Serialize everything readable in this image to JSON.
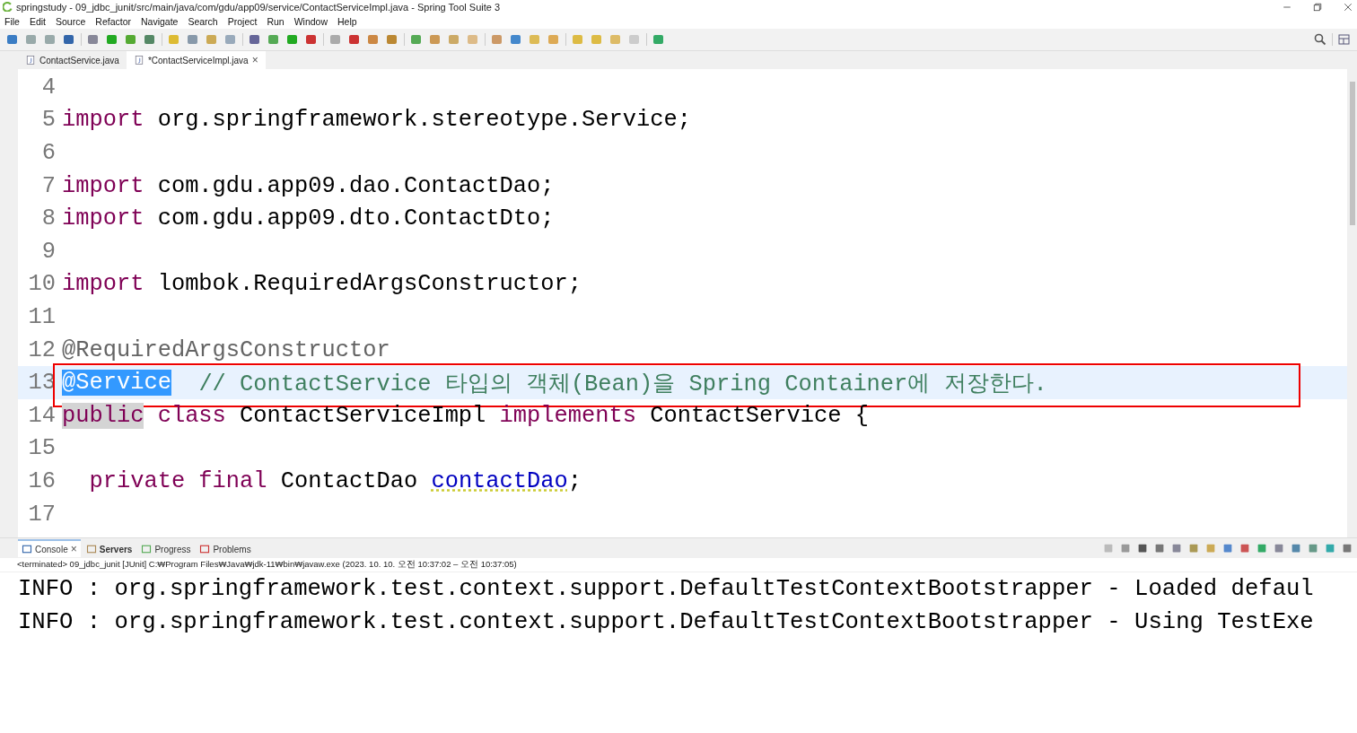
{
  "window": {
    "title": "springstudy - 09_jdbc_junit/src/main/java/com/gdu/app09/service/ContactServiceImpl.java - Spring Tool Suite 3"
  },
  "menu": [
    "File",
    "Edit",
    "Source",
    "Refactor",
    "Navigate",
    "Search",
    "Project",
    "Run",
    "Window",
    "Help"
  ],
  "editor_tabs": [
    {
      "label": "ContactService.java",
      "selected": false
    },
    {
      "label": "*ContactServiceImpl.java",
      "selected": true,
      "close": "×"
    }
  ],
  "code_lines": [
    {
      "number": "4",
      "current": false,
      "boxed": false
    },
    {
      "number": "5",
      "current": false,
      "boxed": false,
      "segments": [
        {
          "kind": "keyword",
          "text": "import"
        },
        {
          "kind": "plain",
          "text": " org.springframework.stereotype.Service;"
        }
      ]
    },
    {
      "number": "6",
      "current": false,
      "boxed": false
    },
    {
      "number": "7",
      "current": false,
      "boxed": false,
      "segments": [
        {
          "kind": "keyword",
          "text": "import"
        },
        {
          "kind": "plain",
          "text": " com.gdu.app09.dao.ContactDao;"
        }
      ]
    },
    {
      "number": "8",
      "current": false,
      "boxed": false,
      "segments": [
        {
          "kind": "keyword",
          "text": "import"
        },
        {
          "kind": "plain",
          "text": " com.gdu.app09.dto.ContactDto;"
        }
      ]
    },
    {
      "number": "9",
      "current": false,
      "boxed": false
    },
    {
      "number": "10",
      "current": false,
      "boxed": false,
      "segments": [
        {
          "kind": "keyword",
          "text": "import"
        },
        {
          "kind": "plain",
          "text": " lombok.RequiredArgsConstructor;"
        }
      ]
    },
    {
      "number": "11",
      "current": false,
      "boxed": false
    },
    {
      "number": "12",
      "current": false,
      "boxed": false,
      "segments": [
        {
          "kind": "annotation",
          "text": "@RequiredArgsConstructor"
        }
      ]
    },
    {
      "number": "13",
      "current": true,
      "boxed": true,
      "segments": [
        {
          "kind": "selection",
          "text": "@Service"
        },
        {
          "kind": "comment",
          "text": "  // ContactService 타입의 객체(Bean)을 Spring Container에 저장한다."
        }
      ]
    },
    {
      "number": "14",
      "current": false,
      "boxed": false,
      "segments": [
        {
          "kind": "occurrence",
          "text": "public"
        },
        {
          "kind": "keyword",
          "text": " class"
        },
        {
          "kind": "plain",
          "text": " ContactServiceImpl "
        },
        {
          "kind": "keyword",
          "text": "implements"
        },
        {
          "kind": "plain",
          "text": " ContactService {"
        }
      ]
    },
    {
      "number": "15",
      "current": false,
      "boxed": false
    },
    {
      "number": "16",
      "current": false,
      "boxed": false,
      "segments": [
        {
          "kind": "keyword",
          "text": "  private final"
        },
        {
          "kind": "plain",
          "text": " ContactDao "
        },
        {
          "kind": "field",
          "text": "contactDao"
        },
        {
          "kind": "plain",
          "text": ";"
        }
      ]
    },
    {
      "number": "17",
      "current": false,
      "boxed": false
    }
  ],
  "console_tabs": [
    {
      "label": "Console",
      "selected": true,
      "close": "×"
    },
    {
      "label": "Servers",
      "selected": false
    },
    {
      "label": "Progress",
      "selected": false
    },
    {
      "label": "Problems",
      "selected": false
    }
  ],
  "console_status": "<terminated> 09_jdbc_junit [JUnit] C:₩Program Files₩Java₩jdk-11₩bin₩javaw.exe  (2023. 10. 10. 오전 10:37:02 – 오전 10:37:05)",
  "console_lines": [
    "INFO : org.springframework.test.context.support.DefaultTestContextBootstrapper - Loaded defaul",
    "INFO : org.springframework.test.context.support.DefaultTestContextBootstrapper - Using TestExe"
  ]
}
